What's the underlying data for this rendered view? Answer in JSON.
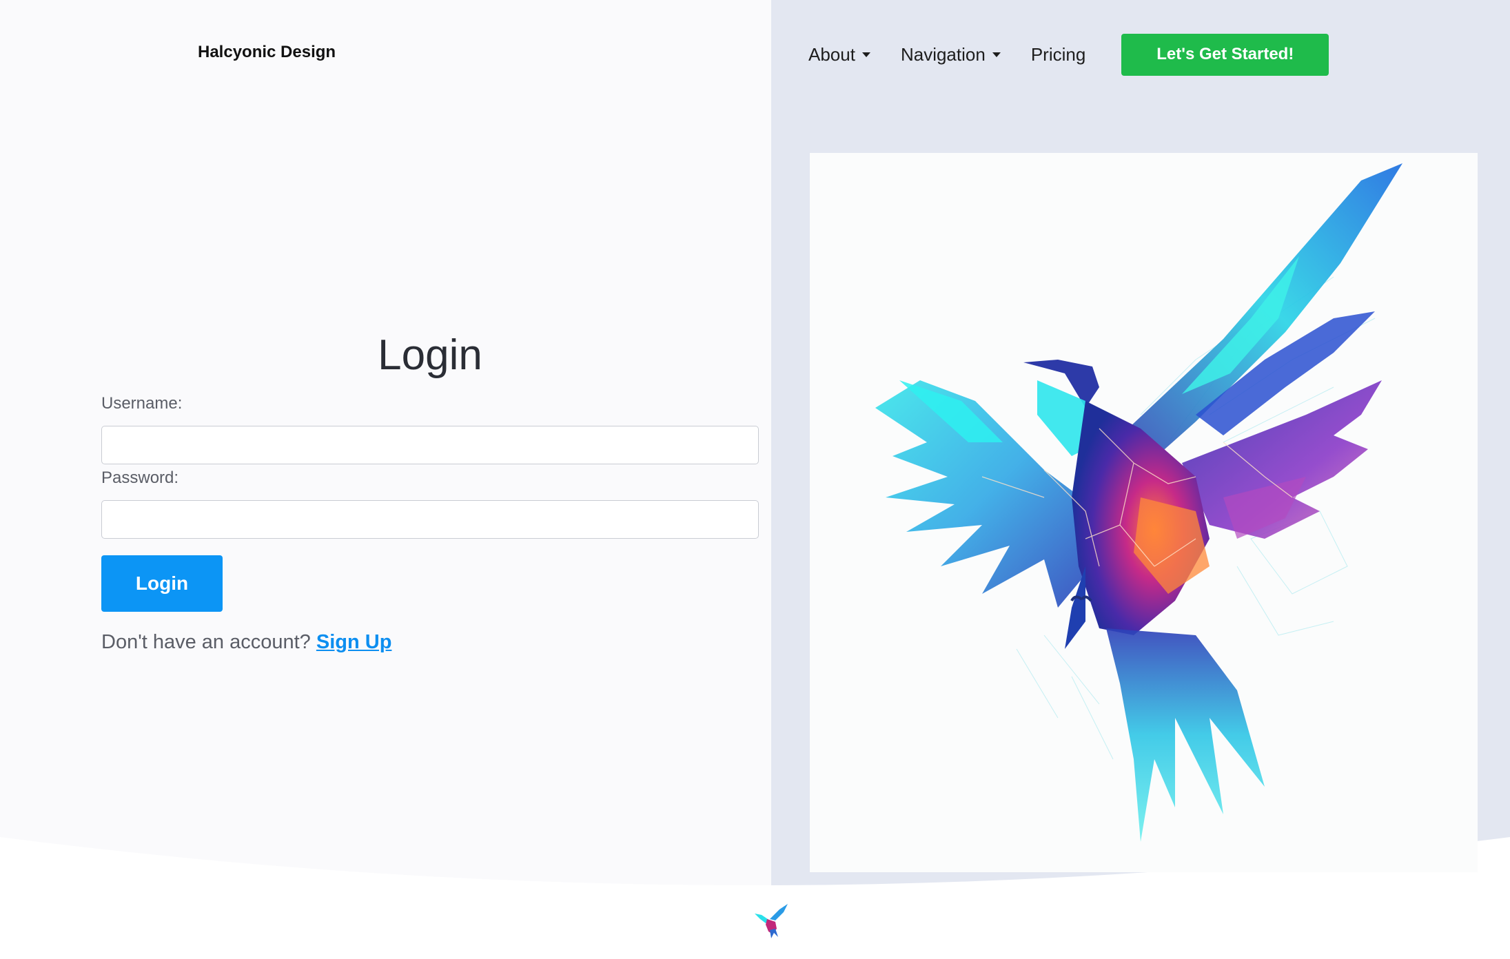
{
  "header": {
    "brand": "Halcyonic Design",
    "nav": [
      {
        "label": "About",
        "has_dropdown": true
      },
      {
        "label": "Navigation",
        "has_dropdown": true
      },
      {
        "label": "Pricing",
        "has_dropdown": false
      }
    ],
    "cta_label": "Let's Get Started!"
  },
  "login": {
    "title": "Login",
    "username_label": "Username:",
    "username_value": "",
    "password_label": "Password:",
    "password_value": "",
    "submit_label": "Login",
    "signup_prompt": "Don't have an account?",
    "signup_link": "Sign Up"
  },
  "hero": {
    "icon": "phoenix-bird-illustration"
  },
  "footer": {
    "icon": "bird-logo-icon"
  },
  "colors": {
    "cta": "#1fbb4b",
    "primary": "#0c95f5",
    "link": "#0c8ef0",
    "left_bg": "#fafafc",
    "right_bg": "#e3e7f1"
  }
}
